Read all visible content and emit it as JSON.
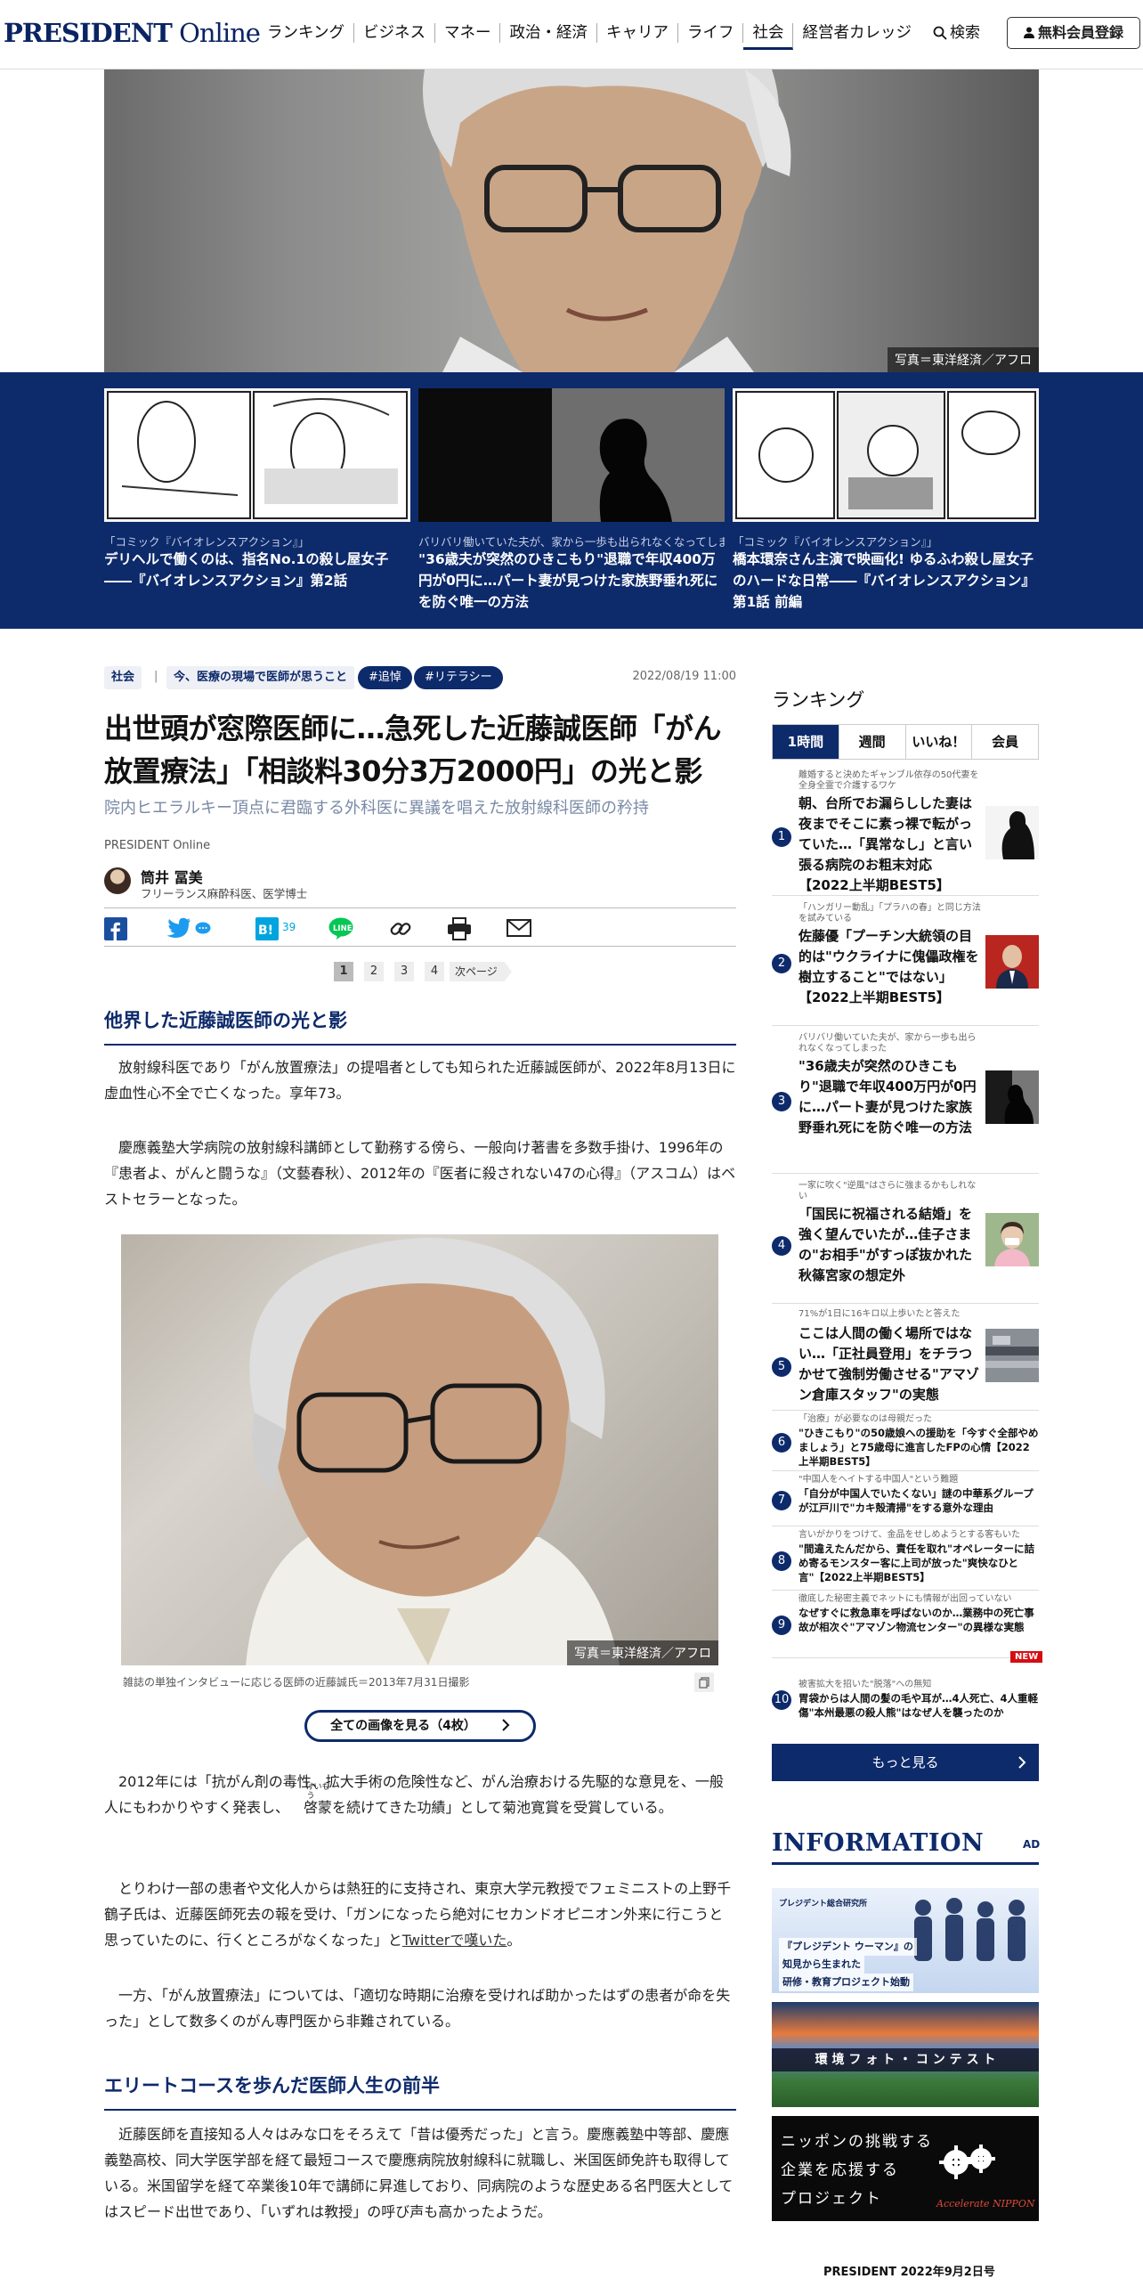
{
  "header": {
    "logo_bold": "PRESIDENT",
    "logo_thin": " Online",
    "nav": [
      "ランキング",
      "ビジネス",
      "マネー",
      "政治・経済",
      "キャリア",
      "ライフ",
      "社会",
      "経営者カレッジ"
    ],
    "active_nav": "社会",
    "search_label": "検索",
    "register_label": "無料会員登録"
  },
  "hero": {
    "credit": "写真＝東洋経済／アフロ"
  },
  "carousel": {
    "items": [
      {
        "small": "「コミック『バイオレンスアクション』」",
        "title": "デリヘルで働くのは、指名No.1の殺し屋女子――『バイオレンスアクション』第2話"
      },
      {
        "small": "バリバリ働いていた夫が、家から一歩も出られなくなってしまった",
        "title": "\"36歳夫が突然のひきこもり\"退職で年収400万円が0円に…パート妻が見つけた家族野垂れ死にを防ぐ唯一の方法"
      },
      {
        "small": "「コミック『バイオレンスアクション』」",
        "title": "橋本環奈さん主演で映画化! ゆるふわ殺し屋女子のハードな日常――『バイオレンスアクション』第1話 前編"
      }
    ]
  },
  "article": {
    "tags": [
      {
        "label": "社会"
      },
      {
        "label": "今、医療の現場で医師が思うこと"
      },
      {
        "label": "#追悼"
      },
      {
        "label": "#リテラシー"
      }
    ],
    "date": "2022/08/19 11:00",
    "title_line1": "出世頭が窓際医師に…急死した近藤誠医師「がん",
    "title_line2": "放置療法」「相談料30分3万2000円」の光と影",
    "subtitle": "院内ヒエラルキー頂点に君臨する外科医に異議を唱えた放射線科医師の矜持",
    "source": "PRESIDENT Online",
    "author": {
      "name": "筒井 冨美",
      "role": "フリーランス麻酔科医、医学博士"
    },
    "share": {
      "hatena_count": "39"
    },
    "pager": {
      "pages": [
        "1",
        "2",
        "3",
        "4"
      ],
      "next": "次ページ"
    },
    "heading1": "他界した近藤誠医師の光と影",
    "p1": "放射線科医であり「がん放置療法」の提唱者としても知られた近藤誠医師が、2022年8月13日に虚血性心不全で亡くなった。享年73。",
    "p2": "慶應義塾大学病院の放射線科講師として勤務する傍ら、一般向け著書を多数手掛け、1996年の『患者よ、がんと闘うな』（文藝春秋）、2012年の『医者に殺されない47の心得』（アスコム）はベストセラーとなった。",
    "photo": {
      "credit": "写真＝東洋経済／アフロ",
      "caption": "雑誌の単独インタビューに応じる医師の近藤誠氏＝2013年7月31日撮影"
    },
    "all_images": "全ての画像を見る（4枚）",
    "p3_before": "2012年には「抗がん剤の毒性、拡大手術の危険性など、がん治療おける先駆的な意見を、一般人にもわかりやすく発表し、",
    "p3_ruby_base": "啓蒙",
    "p3_ruby_text": "けいもう",
    "p3_after": "を続けてきた功績」として菊池寛賞を受賞している。",
    "p4_main": "とりわけ一部の患者や文化人からは熱狂的に支持され、東京大学元教授でフェミニストの上野千鶴子氏は、近藤医師死去の報を受け、「ガンになったら絶対にセカンドオピニオン外来に行こうと思っていたのに、行くところがなくなった」と",
    "p4_link": "Twitterで嘆いた",
    "p4_end": "。",
    "p5": "一方、「がん放置療法」については、「適切な時期に治療を受ければ助かったはずの患者が命を失った」として数多くのがん専門医から非難されている。",
    "heading2": "エリートコースを歩んだ医師人生の前半",
    "p6": "近藤医師を直接知る人々はみな口をそろえて「昔は優秀だった」と言う。慶應義塾中等部、慶應義塾高校、同大学医学部を経て最短コースで慶應病院放射線科に就職し、米国医師免許も取得している。米国留学を経て卒業後10年で講師に昇進しており、同病院のような歴史ある名門医大としてはスピード出世であり、「いずれは教授」の呼び声も高かったようだ。"
  },
  "ranking": {
    "heading": "ランキング",
    "tabs": [
      "1時間",
      "週間",
      "いいね！",
      "会員"
    ],
    "items": [
      {
        "num": "1",
        "small": "離婚すると決めたギャンブル依存の50代妻を全身全霊で介護するワケ",
        "title": "朝、台所でお漏らしした妻は夜までそこに素っ裸で転がっていた…「異常なし」と言い張る病院のお粗末対応【2022上半期BEST5】"
      },
      {
        "num": "2",
        "small": "「ハンガリー動乱」「プラハの春」と同じ方法を試みている",
        "title": "佐藤優「プーチン大統領の目的は\"ウクライナに傀儡政権を樹立すること\"ではない」【2022上半期BEST5】"
      },
      {
        "num": "3",
        "small": "バリバリ働いていた夫が、家から一歩も出られなくなってしまった",
        "title": "\"36歳夫が突然のひきこもり\"退職で年収400万円が0円に…パート妻が見つけた家族野垂れ死にを防ぐ唯一の方法"
      },
      {
        "num": "4",
        "small": "一家に吹く\"逆風\"はさらに強まるかもしれない",
        "title": "「国民に祝福される結婚」を強く望んでいたが…佳子さまの\"お相手\"がすっぽ抜かれた秋篠宮家の想定外"
      },
      {
        "num": "5",
        "small": "71%が1日に16キロ以上歩いたと答えた",
        "title": "ここは人間の働く場所ではない…「正社員登用」をチラつかせて強制労働させる\"アマゾン倉庫スタッフ\"の実態"
      },
      {
        "num": "6",
        "small": "「治療」が必要なのは母親だった",
        "title": "\"ひきこもり\"の50歳娘への援助を「今すぐ全部やめましょう」と75歳母に進言したFPの心情【2022上半期BEST5】"
      },
      {
        "num": "7",
        "small": "\"中国人をヘイトする中国人\"という難題",
        "title": "「自分が中国人でいたくない」謎の中華系グループが江戸川で\"カキ殻清掃\"をする意外な理由"
      },
      {
        "num": "8",
        "small": "言いがかりをつけて、金品をせしめようとする客もいた",
        "title": "\"間違えたんだから、責任を取れ\"オペレーターに詰め寄るモンスター客に上司が放った\"爽快なひと言\"【2022上半期BEST5】"
      },
      {
        "num": "9",
        "small": "徹底した秘密主義でネットにも情報が出回っていない",
        "title": "なぜすぐに救急車を呼ばないのか…業務中の死亡事故が相次ぐ\"アマゾン物流センター\"の異様な実態",
        "badge": "NEW"
      },
      {
        "num": "10",
        "small": "被害拡大を招いた\"脱落\"への無知",
        "title": "胃袋からは人間の髪の毛や耳が…4人死亡、4人重軽傷\"本州最悪の殺人熊\"はなぜ人を襲ったのか"
      }
    ],
    "more": "もっと見る"
  },
  "information": {
    "heading": "INFORMATION",
    "ad": "AD",
    "banner1": {
      "small": "プレジデント総合研究所",
      "l1": "『プレジデント ウーマン』の",
      "l2": "知見から生まれた",
      "l3": "研修・教育プロジェクト始動"
    },
    "banner2": "環 境 フ ォ ト ・ コ ン テ ス ト",
    "banner3": {
      "l1": "ニッポンの挑戦する",
      "l2": "企業を応援する",
      "l3": "プロジェクト",
      "brand": "Accelerate NIPPON"
    }
  },
  "footer_note": "PRESIDENT 2022年9月2日号"
}
